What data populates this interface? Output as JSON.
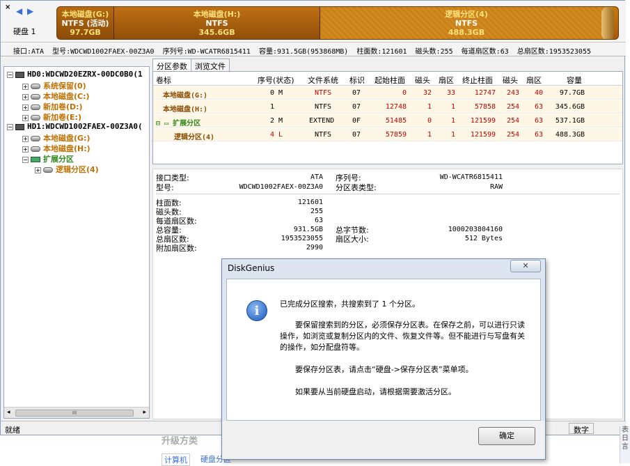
{
  "diskmap": {
    "close": "×",
    "prev": "◀",
    "next": "▶",
    "disk_label": "硬盘 1",
    "segments": [
      {
        "name": "本地磁盘(G:)",
        "fs": "NTFS (活动)",
        "size": "97.7GB"
      },
      {
        "name": "本地磁盘(H:)",
        "fs": "NTFS",
        "size": "345.6GB"
      },
      {
        "name": "逻辑分区(4)",
        "fs": "NTFS",
        "size": "488.3GB"
      }
    ]
  },
  "infoline": {
    "interface": "接口:ATA",
    "model": "型号:WDCWD1002FAEX-00Z3A0",
    "serial": "序列号:WD-WCATR6815411",
    "capacity": "容量:931.5GB(953868MB)",
    "cylinders": "柱面数:121601",
    "heads": "磁头数:255",
    "sectors_per_track": "每道扇区数:63",
    "total_sectors": "总扇区数:1953523055"
  },
  "tree": {
    "items": [
      {
        "label": "HD0:WDCWD20EZRX-00DC0B0(1",
        "exp": "−"
      },
      {
        "label": "系统保留(0)",
        "exp": "+"
      },
      {
        "label": "本地磁盘(C:)",
        "exp": "+"
      },
      {
        "label": "新加卷(D:)",
        "exp": "+"
      },
      {
        "label": "新加卷(E:)",
        "exp": "+"
      },
      {
        "label": "HD1:WDCWD1002FAEX-00Z3A0(",
        "exp": "−"
      },
      {
        "label": "本地磁盘(G:)",
        "exp": "+"
      },
      {
        "label": "本地磁盘(H:)",
        "exp": "+"
      },
      {
        "label": "扩展分区",
        "exp": "−"
      },
      {
        "label": "逻辑分区(4)",
        "exp": "+"
      }
    ],
    "scroll_left": "◂",
    "scroll_right": "▸",
    "scroll_thumb": "III"
  },
  "tabs": [
    "分区参数",
    "浏览文件"
  ],
  "table": {
    "headers": [
      "卷标",
      "序号(状态)",
      "文件系统",
      "标识",
      "起始柱面",
      "磁头",
      "扇区",
      "终止柱面",
      "磁头",
      "扇区",
      "容量"
    ],
    "rows": [
      [
        "本地磁盘(G:)",
        "0 M",
        "NTFS",
        "07",
        "0",
        "32",
        "33",
        "12747",
        "243",
        "40",
        "97.7GB"
      ],
      [
        "本地磁盘(H:)",
        "1",
        "NTFS",
        "07",
        "12748",
        "1",
        "1",
        "57858",
        "254",
        "63",
        "345.6GB"
      ],
      [
        "扩展分区",
        "2 M",
        "EXTEND",
        "0F",
        "51485",
        "0",
        "1",
        "121599",
        "254",
        "63",
        "537.1GB"
      ],
      [
        "逻辑分区(4)",
        "4 L",
        "NTFS",
        "07",
        "57859",
        "1",
        "1",
        "121599",
        "254",
        "63",
        "488.3GB"
      ]
    ]
  },
  "details": {
    "interface_type_label": "接口类型:",
    "interface_type_value": "ATA",
    "serial_label": "序列号:",
    "serial_value": "WD-WCATR6815411",
    "model_label": "型号:",
    "model_value": "WDCWD1002FAEX-00Z3A0",
    "pt_type_label": "分区表类型:",
    "pt_type_value": "RAW",
    "cyl_label": "柱面数:",
    "cyl_value": "121601",
    "heads_label": "磁头数:",
    "heads_value": "255",
    "spt_label": "每道扇区数:",
    "spt_value": "63",
    "cap_label": "总容量:",
    "cap_value": "931.5GB",
    "bytes_label": "总字节数:",
    "bytes_value": "1000203804160",
    "ts_label": "总扇区数:",
    "ts_value": "1953523055",
    "ss_label": "扇区大小:",
    "ss_value": "512 Bytes",
    "extra_label": "附加扇区数:",
    "extra_value": "2990"
  },
  "status": {
    "text": "就绪",
    "numlock": "数字"
  },
  "background": {
    "title": "升级方类",
    "link1": "计算机",
    "link2": "硬盘分区",
    "side": "表日言"
  },
  "dialog": {
    "title": "DiskGenius",
    "close": "✕",
    "icon": "i",
    "line1": "已完成分区搜索，共搜索到了 1 个分区。",
    "line2": "　　要保留搜索到的分区，必须保存分区表。在保存之前，可以进行只读操作，如浏览或复制分区内的文件、恢复文件等。但不能进行与写盘有关的操作，如分配盘符等。",
    "line3": "　　要保存分区表，请点击“硬盘->保存分区表”菜单项。",
    "line4": "　　如果要从当前硬盘启动，请根据需要激活分区。",
    "ok": "确定"
  }
}
